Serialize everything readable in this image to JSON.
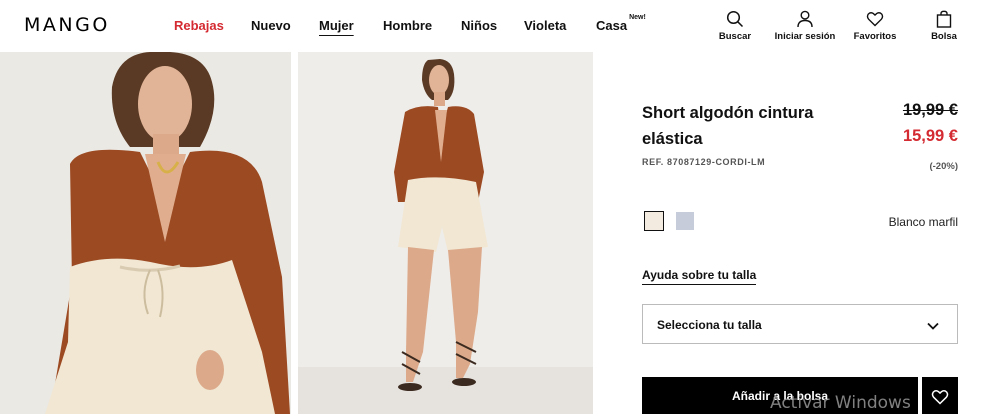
{
  "brand": {
    "logo": "MANGO"
  },
  "nav": {
    "items": [
      {
        "label": "Rebajas"
      },
      {
        "label": "Nuevo"
      },
      {
        "label": "Mujer"
      },
      {
        "label": "Hombre"
      },
      {
        "label": "Niños"
      },
      {
        "label": "Violeta"
      },
      {
        "label": "Casa",
        "badge": "New!"
      }
    ]
  },
  "utils": {
    "search": "Buscar",
    "login": "Iniciar sesión",
    "favorites": "Favoritos",
    "bag": "Bolsa"
  },
  "product": {
    "title": "Short algodón cintura elástica",
    "old_price": "19,99 €",
    "new_price": "15,99 €",
    "ref": "REF. 87087129-CORDI-LM",
    "discount": "(-20%)",
    "color_name": "Blanco marfil",
    "swatch_colors": [
      "#f3ebdf",
      "#c7ccdb"
    ]
  },
  "size": {
    "help": "Ayuda sobre tu talla",
    "select_placeholder": "Selecciona tu talla"
  },
  "actions": {
    "add_to_bag": "Añadir a la bolsa"
  },
  "overlay": {
    "watermark": "Activar Windows"
  },
  "colors": {
    "sale_red": "#d42a31",
    "black": "#000000"
  }
}
